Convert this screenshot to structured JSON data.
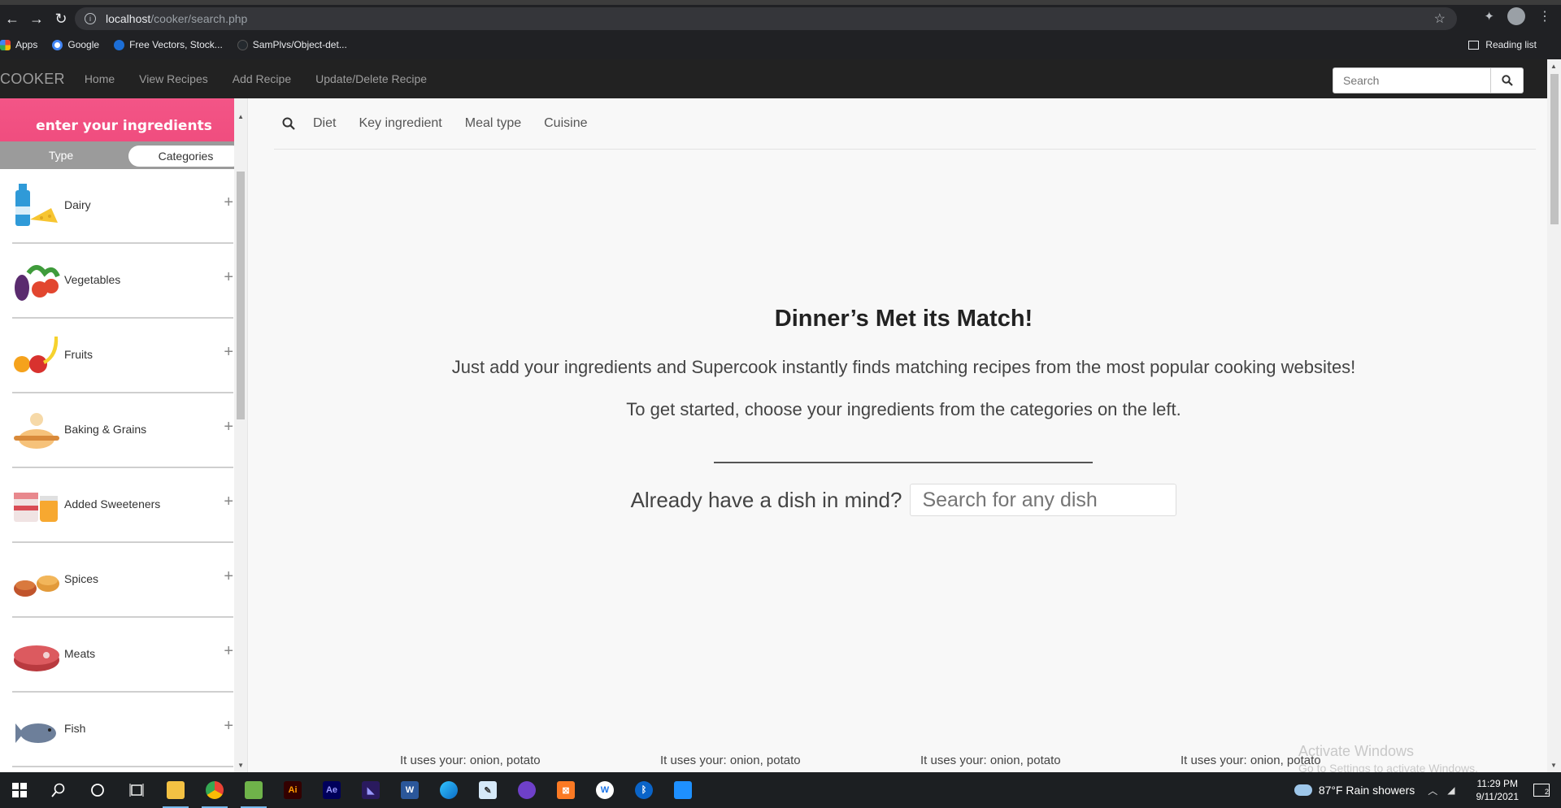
{
  "browser": {
    "url_host": "localhost",
    "url_path": "/cooker/search.php",
    "bookmarks": [
      {
        "label": "Apps",
        "icon": "apps-grid-icon"
      },
      {
        "label": "Google",
        "icon": "google-icon"
      },
      {
        "label": "Free Vectors, Stock...",
        "icon": "freepik-icon"
      },
      {
        "label": "SamPlvs/Object-det...",
        "icon": "github-icon"
      }
    ],
    "reading_list": "Reading list"
  },
  "navbar": {
    "brand": "COOKER",
    "links": [
      "Home",
      "View Recipes",
      "Add Recipe",
      "Update/Delete Recipe"
    ],
    "search_placeholder": "Search"
  },
  "sidebar": {
    "title": "enter your ingredients",
    "tabs": {
      "type": "Type",
      "categories": "Categories",
      "active": "Categories"
    },
    "categories": [
      {
        "label": "Dairy",
        "icon": "dairy-icon"
      },
      {
        "label": "Vegetables",
        "icon": "vegetables-icon"
      },
      {
        "label": "Fruits",
        "icon": "fruits-icon"
      },
      {
        "label": "Baking & Grains",
        "icon": "baking-icon"
      },
      {
        "label": "Added Sweeteners",
        "icon": "sweeteners-icon"
      },
      {
        "label": "Spices",
        "icon": "spices-icon"
      },
      {
        "label": "Meats",
        "icon": "meat-icon"
      },
      {
        "label": "Fish",
        "icon": "fish-icon"
      }
    ]
  },
  "main": {
    "filters": [
      "Diet",
      "Key ingredient",
      "Meal type",
      "Cuisine"
    ],
    "hero_title": "Dinner’s Met its Match!",
    "hero_line1": "Just add your ingredients and Supercook instantly finds matching recipes from the most popular cooking websites!",
    "hero_line2": "To get started, choose your ingredients from the categories on the left.",
    "dish_question": "Already have a dish in mind?",
    "dish_placeholder": "Search for any dish",
    "uses": [
      "It uses your: onion, potato",
      "It uses your: onion, potato",
      "It uses your: onion, potato",
      "It uses your: onion, potato"
    ]
  },
  "watermark": {
    "title": "Activate Windows",
    "subtitle": "Go to Settings to activate Windows."
  },
  "taskbar": {
    "apps": [
      "start",
      "search",
      "cortana",
      "task-view",
      "file-explorer",
      "chrome",
      "notepad",
      "illustrator",
      "after-effects",
      "premiere",
      "word",
      "edge",
      "paint",
      "github-desktop",
      "xampp",
      "writer",
      "bluetooth",
      "photos"
    ],
    "weather": "87°F  Rain showers",
    "time": "11:29 PM",
    "date": "9/11/2021",
    "notifications": "2"
  },
  "colors": {
    "sidebar_header": "#f35587",
    "navbar": "#222222",
    "taskbar": "#1c1f22"
  }
}
